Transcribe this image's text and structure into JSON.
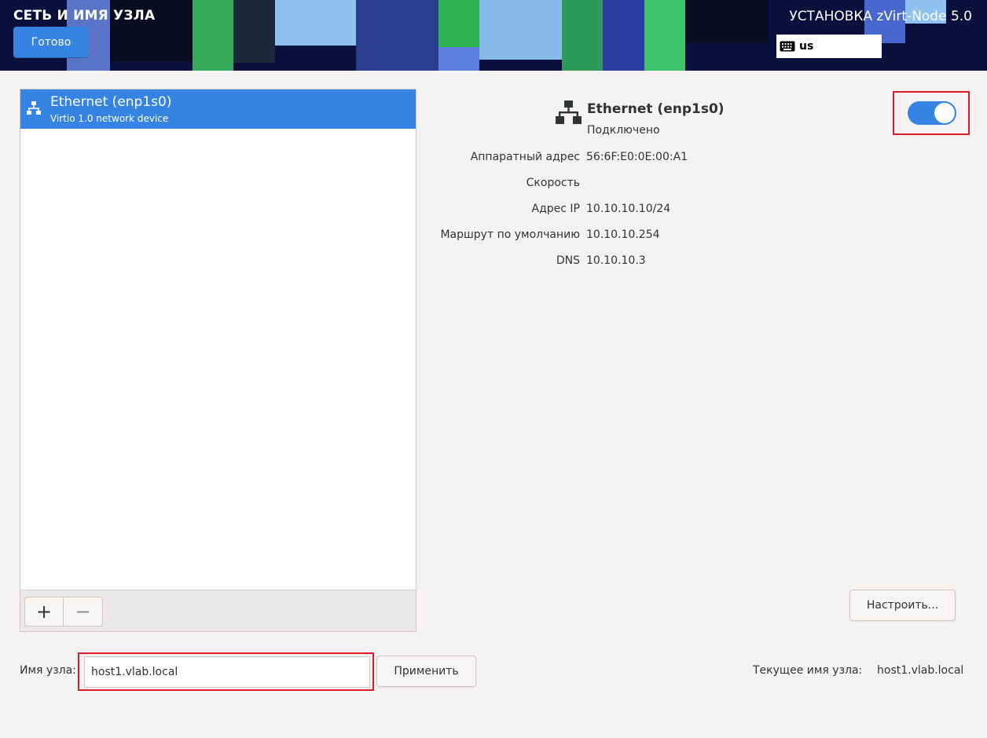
{
  "header": {
    "title": "СЕТЬ И ИМЯ УЗЛА",
    "done_label": "Готово",
    "install_title": "УСТАНОВКА zVirt-Node 5.0",
    "keyboard_layout": "us",
    "accent_color": "#3584e4"
  },
  "interfaces": [
    {
      "name": "Ethernet (enp1s0)",
      "description": "Virtio 1.0 network device",
      "icon": "network-wired-icon"
    }
  ],
  "list_toolbar": {
    "add_label": "+",
    "remove_label": "−"
  },
  "details": {
    "name": "Ethernet (enp1s0)",
    "status": "Подключено",
    "enabled": true,
    "properties": [
      {
        "label": "Аппаратный адрес",
        "value": "56:6F:E0:0E:00:A1"
      },
      {
        "label": "Скорость",
        "value": ""
      },
      {
        "label": "Адрес IP",
        "value": "10.10.10.10/24"
      },
      {
        "label": "Маршрут по умолчанию",
        "value": "10.10.10.254"
      },
      {
        "label": "DNS",
        "value": "10.10.10.3"
      }
    ],
    "configure_label": "Настроить..."
  },
  "hostname": {
    "label": "Имя узла:",
    "value": "host1.vlab.local",
    "apply_label": "Применить",
    "current_label": "Текущее имя узла:",
    "current_value": "host1.vlab.local"
  },
  "highlight_color": "#e01b24"
}
